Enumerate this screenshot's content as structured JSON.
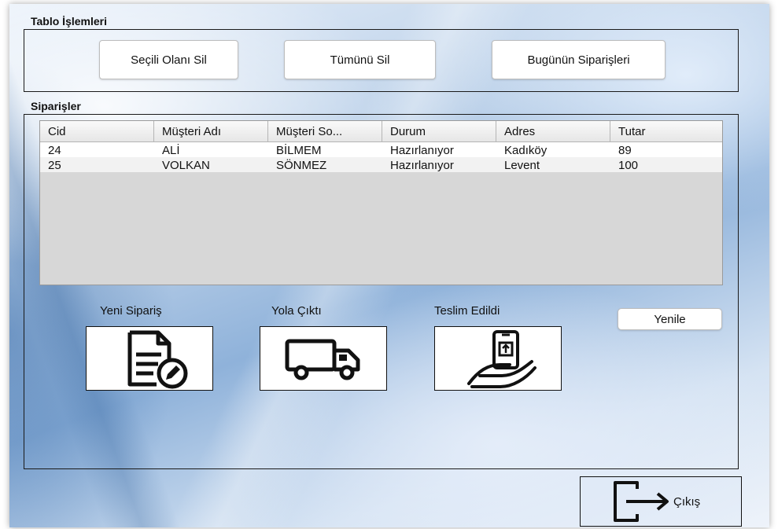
{
  "table_operations": {
    "title": "Tablo İşlemleri",
    "buttons": {
      "delete_selected": "Seçili Olanı Sil",
      "delete_all": "Tümünü Sil",
      "todays_orders": "Bugünün Siparişleri"
    }
  },
  "orders": {
    "title": "Siparişler",
    "columns": [
      "Cid",
      "Müşteri Adı",
      "Müşteri So...",
      "Durum",
      "Adres",
      "Tutar"
    ],
    "rows": [
      [
        "24",
        "ALİ",
        "BİLMEM",
        "Hazırlanıyor",
        "Kadıköy",
        "89"
      ],
      [
        "25",
        "VOLKAN",
        "SÖNMEZ",
        "Hazırlanıyor",
        "Levent",
        "100"
      ]
    ]
  },
  "actions": {
    "new_order": "Yeni Sipariş",
    "on_the_way": "Yola Çıktı",
    "delivered": "Teslim Edildi",
    "refresh": "Yenile"
  },
  "exit": {
    "label": "Çıkış"
  }
}
